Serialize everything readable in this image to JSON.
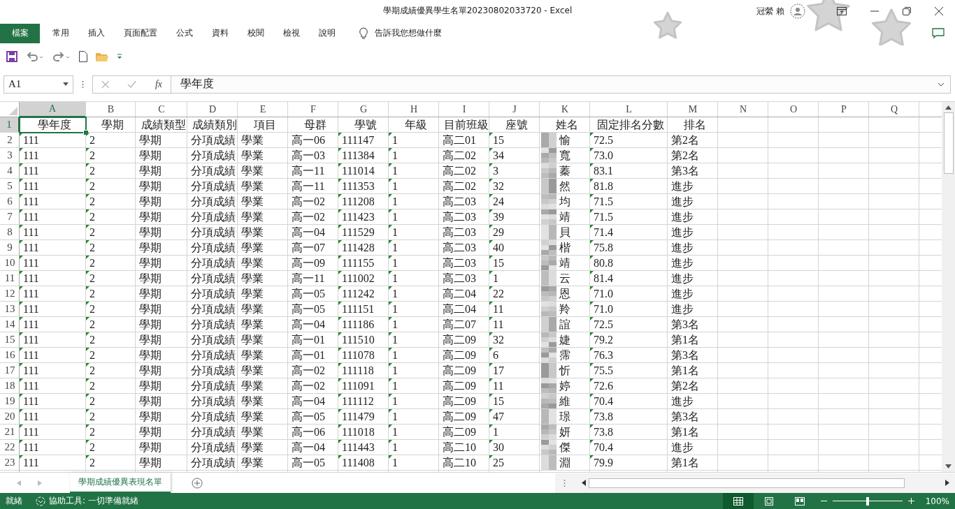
{
  "window": {
    "title": "學期成績優異學生名單20230802033720  -  Excel",
    "user": "冠縈 賴"
  },
  "ribbon_tabs": [
    {
      "label": "檔案",
      "kind": "file"
    },
    {
      "label": "常用",
      "kind": "tab"
    },
    {
      "label": "插入",
      "kind": "tab"
    },
    {
      "label": "頁面配置",
      "kind": "tab"
    },
    {
      "label": "公式",
      "kind": "tab"
    },
    {
      "label": "資料",
      "kind": "tab"
    },
    {
      "label": "校閱",
      "kind": "tab"
    },
    {
      "label": "檢視",
      "kind": "tab"
    },
    {
      "label": "說明",
      "kind": "tab"
    }
  ],
  "tell_me": "告訴我您想做什麼",
  "formula_bar": {
    "name_box": "A1",
    "function_button": "fx",
    "formula": "學年度"
  },
  "columns": [
    {
      "letter": "A",
      "selected": true,
      "kind": "number_as_text"
    },
    {
      "letter": "B",
      "selected": false,
      "kind": "number_as_text"
    },
    {
      "letter": "C",
      "selected": false,
      "kind": "plain"
    },
    {
      "letter": "D",
      "selected": false,
      "kind": "plain"
    },
    {
      "letter": "E",
      "selected": false,
      "kind": "plain"
    },
    {
      "letter": "F",
      "selected": false,
      "kind": "plain"
    },
    {
      "letter": "G",
      "selected": false,
      "kind": "number_as_text"
    },
    {
      "letter": "H",
      "selected": false,
      "kind": "number_as_text"
    },
    {
      "letter": "I",
      "selected": false,
      "kind": "plain"
    },
    {
      "letter": "J",
      "selected": false,
      "kind": "number_as_text"
    },
    {
      "letter": "K",
      "selected": false,
      "kind": "blurred"
    },
    {
      "letter": "L",
      "selected": false,
      "kind": "number_as_text"
    },
    {
      "letter": "M",
      "selected": false,
      "kind": "plain"
    },
    {
      "letter": "N",
      "selected": false,
      "kind": "plain"
    },
    {
      "letter": "O",
      "selected": false,
      "kind": "plain"
    },
    {
      "letter": "P",
      "selected": false,
      "kind": "plain"
    },
    {
      "letter": "Q",
      "selected": false,
      "kind": "plain"
    }
  ],
  "rows": [
    {
      "number": "1",
      "selected": true,
      "kind": "header",
      "cells": [
        "學年度",
        "學期",
        "成績類型",
        "成績類別",
        "項目",
        "母群",
        "學號",
        "年級",
        "目前班級",
        "座號",
        "姓名",
        "固定排名分數",
        "排名"
      ]
    },
    {
      "number": "2",
      "selected": false,
      "kind": "data",
      "cells": [
        "111",
        "2",
        "學期",
        "分項成績",
        "學業",
        "高一06",
        "111147",
        "1",
        "高二01",
        "15",
        "愉",
        "72.5",
        "第2名"
      ]
    },
    {
      "number": "3",
      "selected": false,
      "kind": "data",
      "cells": [
        "111",
        "2",
        "學期",
        "分項成績",
        "學業",
        "高一03",
        "111384",
        "1",
        "高二02",
        "34",
        "寬",
        "73.0",
        "第2名"
      ]
    },
    {
      "number": "4",
      "selected": false,
      "kind": "data",
      "cells": [
        "111",
        "2",
        "學期",
        "分項成績",
        "學業",
        "高一11",
        "111014",
        "1",
        "高二02",
        "3",
        "蓁",
        "83.1",
        "第3名"
      ]
    },
    {
      "number": "5",
      "selected": false,
      "kind": "data",
      "cells": [
        "111",
        "2",
        "學期",
        "分項成績",
        "學業",
        "高一11",
        "111353",
        "1",
        "高二02",
        "32",
        "然",
        "81.8",
        "進步"
      ]
    },
    {
      "number": "6",
      "selected": false,
      "kind": "data",
      "cells": [
        "111",
        "2",
        "學期",
        "分項成績",
        "學業",
        "高一02",
        "111208",
        "1",
        "高二03",
        "24",
        "均",
        "71.5",
        "進步"
      ]
    },
    {
      "number": "7",
      "selected": false,
      "kind": "data",
      "cells": [
        "111",
        "2",
        "學期",
        "分項成績",
        "學業",
        "高一02",
        "111423",
        "1",
        "高二03",
        "39",
        "靖",
        "71.5",
        "進步"
      ]
    },
    {
      "number": "8",
      "selected": false,
      "kind": "data",
      "cells": [
        "111",
        "2",
        "學期",
        "分項成績",
        "學業",
        "高一04",
        "111529",
        "1",
        "高二03",
        "29",
        "貝",
        "71.4",
        "進步"
      ]
    },
    {
      "number": "9",
      "selected": false,
      "kind": "data",
      "cells": [
        "111",
        "2",
        "學期",
        "分項成績",
        "學業",
        "高一07",
        "111428",
        "1",
        "高二03",
        "40",
        "楷",
        "75.8",
        "進步"
      ]
    },
    {
      "number": "10",
      "selected": false,
      "kind": "data",
      "cells": [
        "111",
        "2",
        "學期",
        "分項成績",
        "學業",
        "高一09",
        "111155",
        "1",
        "高二03",
        "15",
        "靖",
        "80.8",
        "進步"
      ]
    },
    {
      "number": "11",
      "selected": false,
      "kind": "data",
      "cells": [
        "111",
        "2",
        "學期",
        "分項成績",
        "學業",
        "高一11",
        "111002",
        "1",
        "高二03",
        "1",
        "云",
        "81.4",
        "進步"
      ]
    },
    {
      "number": "12",
      "selected": false,
      "kind": "data",
      "cells": [
        "111",
        "2",
        "學期",
        "分項成績",
        "學業",
        "高一05",
        "111242",
        "1",
        "高二04",
        "22",
        "恩",
        "71.0",
        "進步"
      ]
    },
    {
      "number": "13",
      "selected": false,
      "kind": "data",
      "cells": [
        "111",
        "2",
        "學期",
        "分項成績",
        "學業",
        "高一05",
        "111151",
        "1",
        "高二04",
        "11",
        "羚",
        "71.0",
        "進步"
      ]
    },
    {
      "number": "14",
      "selected": false,
      "kind": "data",
      "cells": [
        "111",
        "2",
        "學期",
        "分項成績",
        "學業",
        "高一04",
        "111186",
        "1",
        "高二07",
        "11",
        "誼",
        "72.5",
        "第3名"
      ]
    },
    {
      "number": "15",
      "selected": false,
      "kind": "data",
      "cells": [
        "111",
        "2",
        "學期",
        "分項成績",
        "學業",
        "高一01",
        "111510",
        "1",
        "高二09",
        "32",
        "婕",
        "79.2",
        "第1名"
      ]
    },
    {
      "number": "16",
      "selected": false,
      "kind": "data",
      "cells": [
        "111",
        "2",
        "學期",
        "分項成績",
        "學業",
        "高一01",
        "111078",
        "1",
        "高二09",
        "6",
        "霈",
        "76.3",
        "第3名"
      ]
    },
    {
      "number": "17",
      "selected": false,
      "kind": "data",
      "cells": [
        "111",
        "2",
        "學期",
        "分項成績",
        "學業",
        "高一02",
        "111118",
        "1",
        "高二09",
        "17",
        "忻",
        "75.5",
        "第1名"
      ]
    },
    {
      "number": "18",
      "selected": false,
      "kind": "data",
      "cells": [
        "111",
        "2",
        "學期",
        "分項成績",
        "學業",
        "高一02",
        "111091",
        "1",
        "高二09",
        "11",
        "婷",
        "72.6",
        "第2名"
      ]
    },
    {
      "number": "19",
      "selected": false,
      "kind": "data",
      "cells": [
        "111",
        "2",
        "學期",
        "分項成績",
        "學業",
        "高一04",
        "111112",
        "1",
        "高二09",
        "15",
        "維",
        "70.4",
        "進步"
      ]
    },
    {
      "number": "20",
      "selected": false,
      "kind": "data",
      "cells": [
        "111",
        "2",
        "學期",
        "分項成績",
        "學業",
        "高一05",
        "111479",
        "1",
        "高二09",
        "47",
        "璟",
        "73.8",
        "第3名"
      ]
    },
    {
      "number": "21",
      "selected": false,
      "kind": "data",
      "cells": [
        "111",
        "2",
        "學期",
        "分項成績",
        "學業",
        "高一06",
        "111018",
        "1",
        "高二09",
        "1",
        "妍",
        "73.8",
        "第1名"
      ]
    },
    {
      "number": "22",
      "selected": false,
      "kind": "data",
      "cells": [
        "111",
        "2",
        "學期",
        "分項成績",
        "學業",
        "高一04",
        "111443",
        "1",
        "高二10",
        "30",
        "傑",
        "70.4",
        "進步"
      ]
    },
    {
      "number": "23",
      "selected": false,
      "kind": "data",
      "cells": [
        "111",
        "2",
        "學期",
        "分項成績",
        "學業",
        "高一05",
        "111408",
        "1",
        "高二10",
        "25",
        "淵",
        "79.9",
        "第1名"
      ]
    }
  ],
  "sheet_tabs": [
    {
      "label": "學期成績優異表現名單",
      "selected": true
    }
  ],
  "status_bar": {
    "mode": "就緒",
    "accessibility": "協助工具: 一切準備就緒",
    "views": [
      {
        "kind": "normal",
        "selected": true
      },
      {
        "kind": "page_layout",
        "selected": false
      },
      {
        "kind": "page_break",
        "selected": false
      }
    ],
    "zoom": "100%",
    "zoom_slider": {
      "level": 0.5
    }
  }
}
